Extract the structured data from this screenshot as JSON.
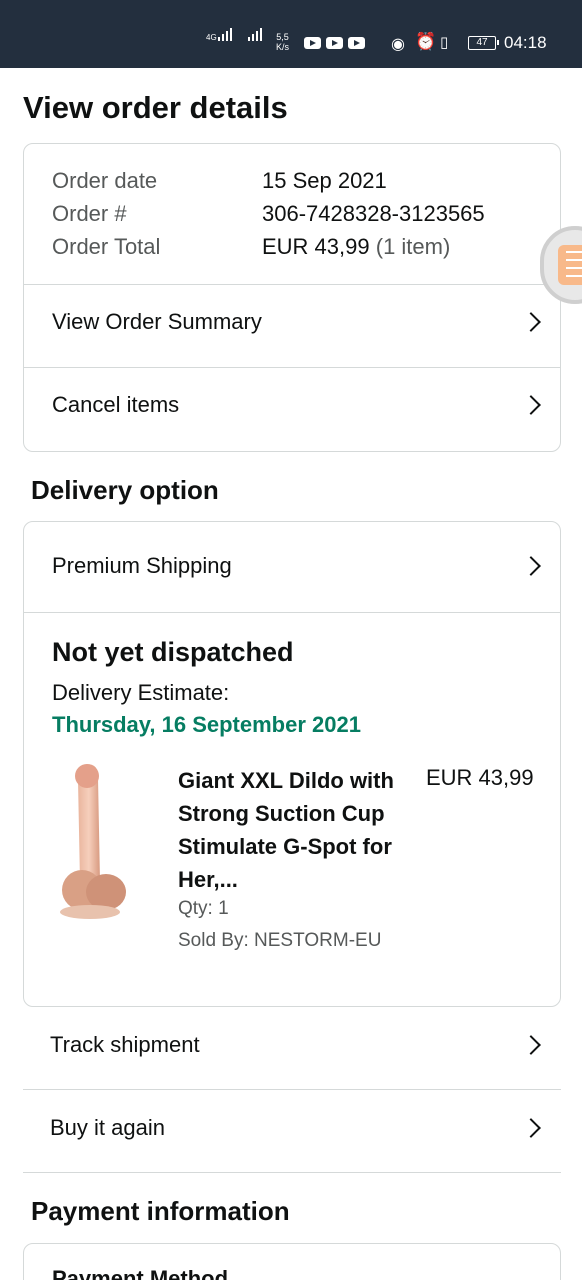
{
  "status_bar": {
    "network_type": "4G",
    "speed_value": "5,5",
    "speed_unit": "K/s",
    "battery_level": "47",
    "time": "04:18",
    "icons": [
      "signal-icon",
      "signal-icon",
      "youtube-icon",
      "youtube-icon",
      "youtube-icon",
      "eye-icon",
      "alarm-icon",
      "vibrate-icon",
      "battery-icon"
    ]
  },
  "page": {
    "title": "View order details"
  },
  "order": {
    "date_label": "Order date",
    "date_value": "15 Sep 2021",
    "number_label": "Order #",
    "number_value": "306-7428328-3123565",
    "total_label": "Order Total",
    "total_value": "EUR 43,99",
    "total_items": "(1 item)"
  },
  "order_links": {
    "summary": "View Order Summary",
    "cancel": "Cancel items"
  },
  "delivery": {
    "section_title": "Delivery option",
    "shipping_option": "Premium Shipping",
    "status": "Not yet dispatched",
    "estimate_label": "Delivery Estimate:",
    "estimate_date": "Thursday, 16 September 2021",
    "estimate_color": "#067d62"
  },
  "product": {
    "title": "Giant XXL Dildo with Strong Suction Cup Stimulate G-Spot for Her,...",
    "price": "EUR 43,99",
    "qty": "Qty: 1",
    "seller": "Sold By: NESTORM-EU"
  },
  "actions": {
    "track": "Track shipment",
    "buy_again": "Buy it again"
  },
  "payment": {
    "section_title": "Payment information",
    "method_label": "Payment Method"
  },
  "colors": {
    "status_bar_bg": "#232f3e",
    "border": "#d5d9d9",
    "text": "#0f1111",
    "muted": "#565959"
  }
}
